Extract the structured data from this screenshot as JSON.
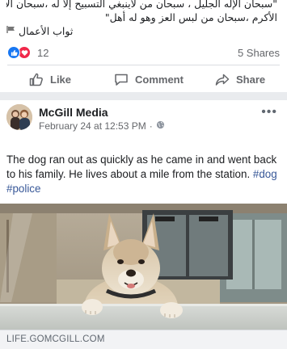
{
  "previous_post": {
    "text_lines": [
      "\"سبحان الإله الجليل ، سبحان من لاينبغي التسبيح إلا له ،سبحان الأعز",
      "الأكرم ،سبحان من لبس العز وهو له أهل\""
    ],
    "tag_text": "ثواب الأعمال",
    "reaction_count": "12",
    "shares": "5 Shares",
    "actions": {
      "like": "Like",
      "comment": "Comment",
      "share": "Share"
    }
  },
  "post": {
    "page_name": "McGill Media",
    "date": "February 24 at 12:53 PM",
    "separator": "·",
    "more": "•••",
    "text": "The dog ran out as quickly as he came in and went back to his family. He lives about a mile from the station.",
    "hashtags": [
      "#dog",
      "#police"
    ],
    "link_domain": "LIFE.GOMCGILL.COM"
  },
  "colors": {
    "brand_blue": "#1877f2",
    "love_red": "#f0284a",
    "link_blue": "#385898"
  }
}
